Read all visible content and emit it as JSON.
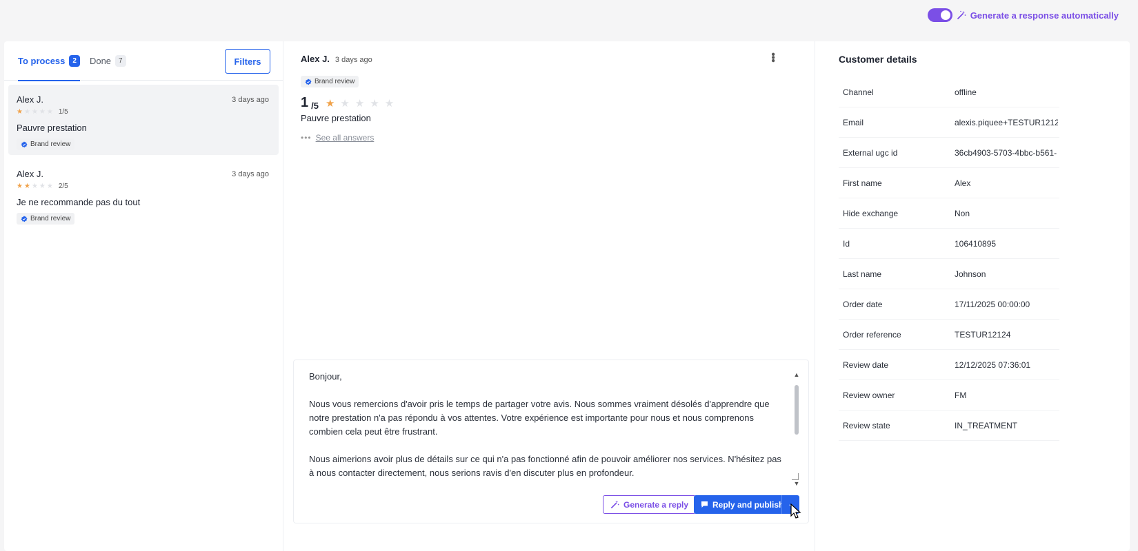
{
  "header": {
    "auto_label": "Generate a response automatically",
    "toggle_on": true,
    "accent_color": "#7b4fe6"
  },
  "tabs": {
    "to_process_label": "To process",
    "to_process_count": "2",
    "done_label": "Done",
    "done_count": "7",
    "filters_label": "Filters"
  },
  "reviews": [
    {
      "author": "Alex J.",
      "date": "3 days ago",
      "rating": 1,
      "score": "1/5",
      "text": "Pauvre prestation",
      "tag": "Brand review",
      "selected": true
    },
    {
      "author": "Alex J.",
      "date": "3 days ago",
      "rating": 2,
      "score": "2/5",
      "text": "Je ne recommande pas du tout",
      "tag": "Brand review",
      "selected": false
    }
  ],
  "detail": {
    "author": "Alex J.",
    "date": "3 days ago",
    "tag": "Brand review",
    "score_big": "1",
    "score_small": "/5",
    "rating": 1,
    "title": "Pauvre prestation",
    "see_all": "See all answers"
  },
  "reply": {
    "text": "Bonjour,\n\nNous vous remercions d'avoir pris le temps de partager votre avis. Nous sommes vraiment désolés d'apprendre que notre prestation n'a pas répondu à vos attentes. Votre expérience est importante pour nous et nous comprenons combien cela peut être frustrant.\n\nNous aimerions avoir plus de détails sur ce qui n'a pas fonctionné afin de pouvoir améliorer nos services. N'hésitez pas à nous contacter directement, nous serions ravis d'en discuter plus en profondeur.",
    "generate_label": "Generate a reply",
    "publish_label": "Reply and publish"
  },
  "customer": {
    "title": "Customer details",
    "rows": [
      {
        "key": "Channel",
        "value": "offline"
      },
      {
        "key": "Email",
        "value": "alexis.piquee+TESTUR1212"
      },
      {
        "key": "External ugc id",
        "value": "36cb4903-5703-4bbc-b561-"
      },
      {
        "key": "First name",
        "value": "Alex"
      },
      {
        "key": "Hide exchange",
        "value": "Non"
      },
      {
        "key": "Id",
        "value": "106410895"
      },
      {
        "key": "Last name",
        "value": "Johnson"
      },
      {
        "key": "Order date",
        "value": "17/11/2025 00:00:00"
      },
      {
        "key": "Order reference",
        "value": "TESTUR12124"
      },
      {
        "key": "Review date",
        "value": "12/12/2025 07:36:01"
      },
      {
        "key": "Review owner",
        "value": "FM"
      },
      {
        "key": "Review state",
        "value": "IN_TREATMENT"
      }
    ]
  }
}
